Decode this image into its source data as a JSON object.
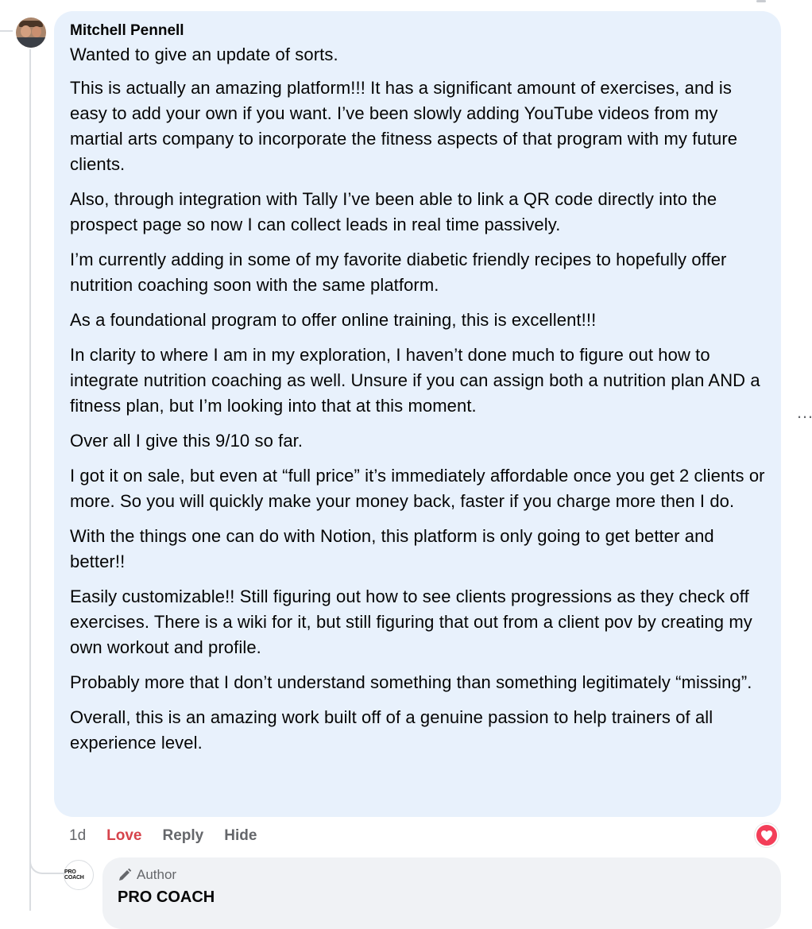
{
  "comment": {
    "author": "Mitchell Pennell",
    "paragraphs": [
      "Wanted to give an update of sorts.",
      "This is actually an amazing platform!!! It has a significant amount of exercises, and is easy to add your own if you want. I’ve been slowly adding YouTube videos from my martial arts company to incorporate the fitness aspects of that program with my future clients.",
      "Also, through integration with Tally I’ve been able to link a QR code directly into the prospect page so now I can collect leads in real time passively.",
      "I’m currently adding in some of my favorite diabetic friendly recipes to hopefully offer nutrition coaching soon with the same platform.",
      "As a foundational program to offer online training, this is excellent!!!",
      "In clarity to where I am in my exploration, I haven’t done much to figure out how to integrate nutrition coaching as well. Unsure if you can assign both a nutrition plan AND a fitness plan, but I’m looking into that at this moment.",
      "Over all I give this 9/10 so far.",
      "I got it on sale, but even at “full price” it’s immediately affordable once you get 2 clients or more. So you will quickly make your money back, faster if you charge more then I do.",
      "With the things one can do with Notion, this platform is only going to get better and better!!",
      "Easily customizable!! Still figuring out how to see clients progressions as they check off exercises. There is a wiki for it, but still figuring that out from a client pov by creating my own workout and profile.",
      "Probably more that I don’t understand something than something legitimately “missing”.",
      "Overall, this is an amazing work built off of a genuine passion to help trainers of all experience level."
    ],
    "time": "1d",
    "love_label": "Love",
    "reply_label": "Reply",
    "hide_label": "Hide",
    "reaction_icon": "heart-icon",
    "reaction_color": "#f33e58",
    "more_icon": "…"
  },
  "reply": {
    "avatar_text": "PRO COACH",
    "badge_icon": "pencil-icon",
    "badge_label": "Author",
    "author": "PRO COACH"
  }
}
